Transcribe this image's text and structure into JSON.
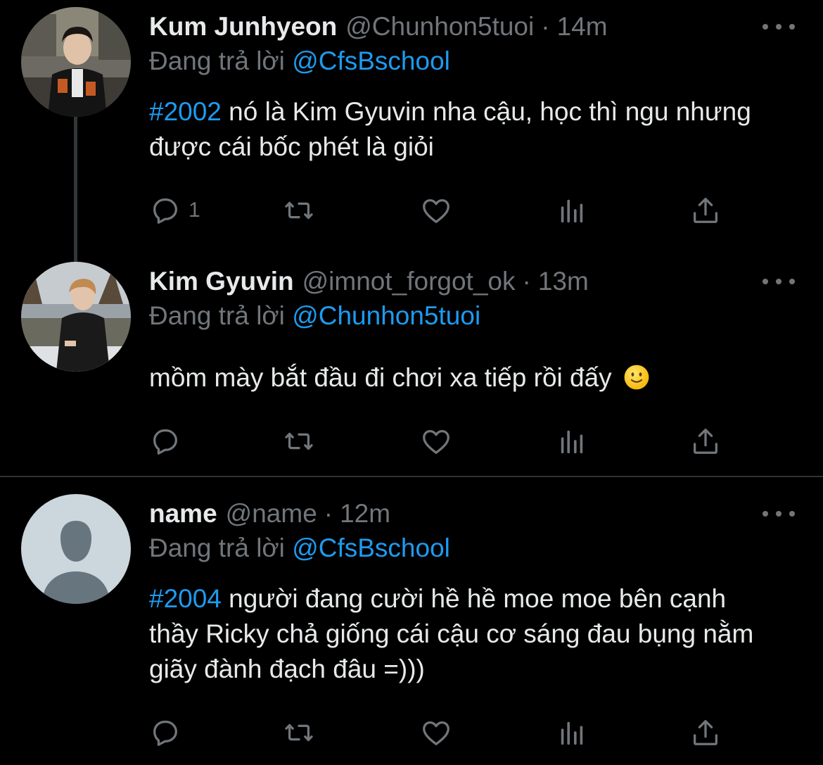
{
  "colors": {
    "background": "#000000",
    "text": "#e7e9ea",
    "secondary_text": "#71767b",
    "accent": "#1d9bf0",
    "divider": "#2f3336"
  },
  "tweets": [
    {
      "display_name": "Kum Junhyeon",
      "handle": "@Chunhon5tuoi",
      "separator": "·",
      "time": "14m",
      "reply_prefix": "Đang trả lời",
      "reply_to": "@CfsBschool",
      "hashtag": "#2002",
      "text": " nó là Kim Gyuvin nha cậu, học thì ngu nhưng được cái bốc phét là giỏi",
      "reply_count": "1",
      "avatar_icon": "user-photo-avatar"
    },
    {
      "display_name": "Kim Gyuvin",
      "handle": "@imnot_forgot_ok",
      "separator": "·",
      "time": "13m",
      "reply_prefix": "Đang trả lời",
      "reply_to": "@Chunhon5tuoi",
      "text": "mồm mày bắt đầu đi chơi xa tiếp rồi đấy",
      "emoji_icon": "slightly-smiling-face-icon",
      "reply_count": "",
      "avatar_icon": "user-photo-avatar"
    },
    {
      "display_name": "name",
      "handle": "@name",
      "separator": "·",
      "time": "12m",
      "reply_prefix": "Đang trả lời",
      "reply_to": "@CfsBschool",
      "hashtag": "#2004",
      "text": " người đang cười hề hề moe moe bên cạnh thầy Ricky chả giống cái cậu cơ sáng đau bụng nằm giãy đành đạch đâu =)))",
      "reply_count": "",
      "avatar_icon": "default-profile-avatar"
    }
  ],
  "action_icons": [
    "reply-icon",
    "retweet-icon",
    "like-icon",
    "analytics-icon",
    "share-icon"
  ],
  "more_icon": "more-dots-icon"
}
